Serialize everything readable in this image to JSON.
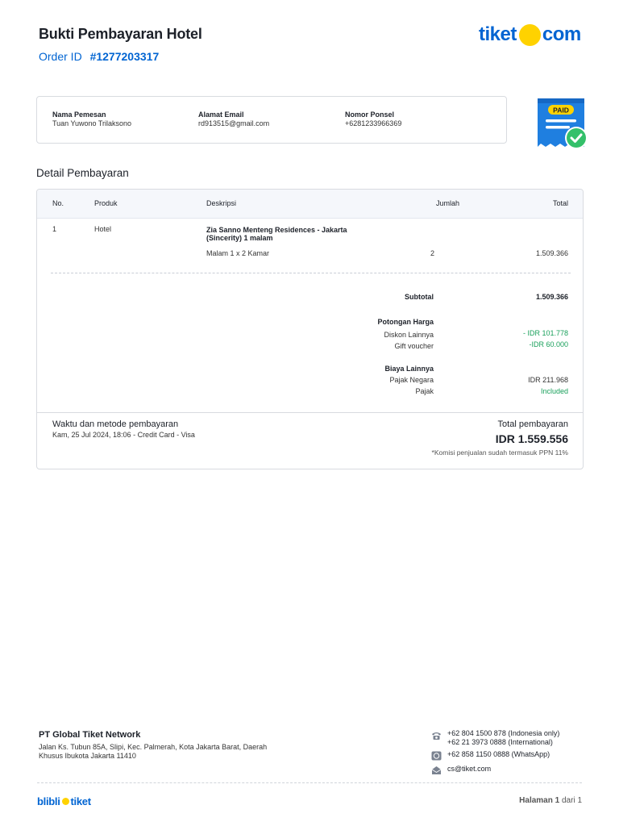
{
  "header": {
    "title": "Bukti Pembayaran Hotel",
    "order_label": "Order ID",
    "order_number": "#1277203317",
    "logo_left": "tiket",
    "logo_right": "com"
  },
  "customer": {
    "name_label": "Nama Pemesan",
    "name_value": "Tuan Yuwono Trilaksono",
    "email_label": "Alamat Email",
    "email_value": "rd913515@gmail.com",
    "phone_label": "Nomor Ponsel",
    "phone_value": "+6281233966369"
  },
  "paid_badge": {
    "label": "PAID",
    "icon": "paid-receipt-icon"
  },
  "detail": {
    "heading": "Detail Pembayaran",
    "columns": {
      "no": "No.",
      "product": "Produk",
      "description": "Deskripsi",
      "qty": "Jumlah",
      "total": "Total"
    },
    "row": {
      "no": "1",
      "product": "Hotel",
      "desc_title_1": "Zia Sanno Menteng Residences - Jakarta",
      "desc_title_2": "(Sincerity) 1 malam",
      "desc_sub": "Malam 1 x 2 Kamar",
      "qty": "2",
      "total": "1.509.366"
    },
    "summary": {
      "subtotal_label": "Subtotal",
      "subtotal_value": "1.509.366",
      "discount_heading": "Potongan Harga",
      "discount1_label": "Diskon Lainnya",
      "discount1_value": "- IDR 101.778",
      "discount2_label": "Gift voucher",
      "discount2_value": "-IDR 60.000",
      "other_heading": "Biaya Lainnya",
      "tax1_label": "Pajak Negara",
      "tax1_value": "IDR 211.968",
      "tax2_label": "Pajak",
      "tax2_value": "Included"
    },
    "payment": {
      "method_heading": "Waktu dan metode pembayaran",
      "method_value": "Kam, 25 Jul 2024, 18:06 - Credit Card - Visa",
      "total_heading": "Total pembayaran",
      "total_value": "IDR 1.559.556",
      "note": "*Komisi penjualan sudah termasuk PPN 11%"
    }
  },
  "footer": {
    "company": "PT Global Tiket Network",
    "address_1": "Jalan Ks. Tubun 85A, Slipi, Kec. Palmerah, Kota Jakarta Barat, Daerah",
    "address_2": "Khusus Ibukota Jakarta 11410",
    "phone_1": "+62 804 1500 878 (Indonesia only)",
    "phone_2": "+62 21 3973 0888 (International)",
    "whatsapp": "+62 858 1150 0888 (WhatsApp)",
    "email": "cs@tiket.com",
    "brand_left": "blibli",
    "brand_right": "tiket",
    "page_label": "Halaman",
    "page_current": "1",
    "page_of": "dari 1"
  },
  "colors": {
    "brand_blue": "#0064d2",
    "brand_yellow": "#ffd200",
    "green": "#19a05b"
  }
}
